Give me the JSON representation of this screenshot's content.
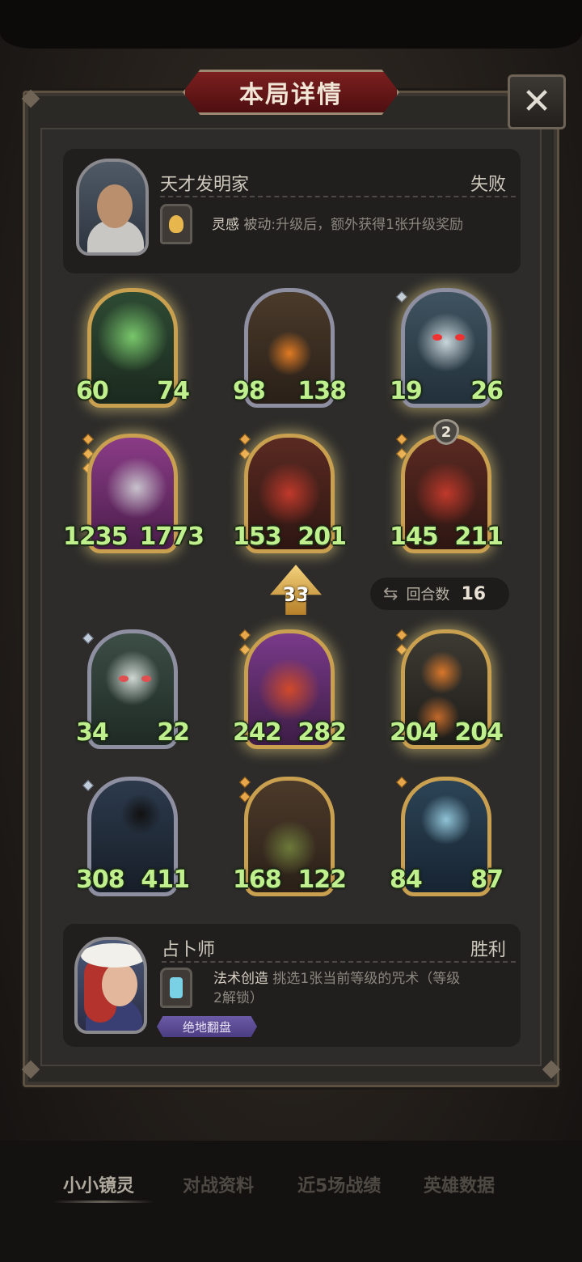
{
  "title": "本局详情",
  "close_icon": "close-x-icon",
  "top_player": {
    "name": "天才发明家",
    "result": "失败",
    "skill_name": "灵感",
    "skill_type": "被动",
    "skill_desc": ":升级后，额外获得1张升级奖励",
    "skill_icon": "lightbulb-icon"
  },
  "units": [
    {
      "atk": "60",
      "hp": "74"
    },
    {
      "atk": "98",
      "hp": "138"
    },
    {
      "atk": "19",
      "hp": "26"
    },
    {
      "atk": "1235",
      "hp": "1773"
    },
    {
      "atk": "153",
      "hp": "201"
    },
    {
      "atk": "145",
      "hp": "211",
      "badge": "2"
    },
    {
      "atk": "34",
      "hp": "22"
    },
    {
      "atk": "242",
      "hp": "282"
    },
    {
      "atk": "204",
      "hp": "204"
    },
    {
      "atk": "308",
      "hp": "411"
    },
    {
      "atk": "168",
      "hp": "122"
    },
    {
      "atk": "84",
      "hp": "87"
    }
  ],
  "level_up_value": "33",
  "rounds": {
    "label": "回合数",
    "value": "16",
    "icon": "repeat-icon"
  },
  "bottom_player": {
    "name": "占卜师",
    "result": "胜利",
    "skill_name": "法术创造",
    "skill_desc": "挑选1张当前等级的咒术（等级",
    "skill_desc2": "2解锁）",
    "skill_icon": "spellbook-icon",
    "tag": "绝地翻盘"
  },
  "tabs": [
    "小小镜灵",
    "对战资料",
    "近5场战绩",
    "英雄数据"
  ],
  "active_tab": 0,
  "colors": {
    "stat_green": "#bff08d",
    "title_red": "#7c1f1f",
    "gold_frame": "#c9a04f"
  }
}
